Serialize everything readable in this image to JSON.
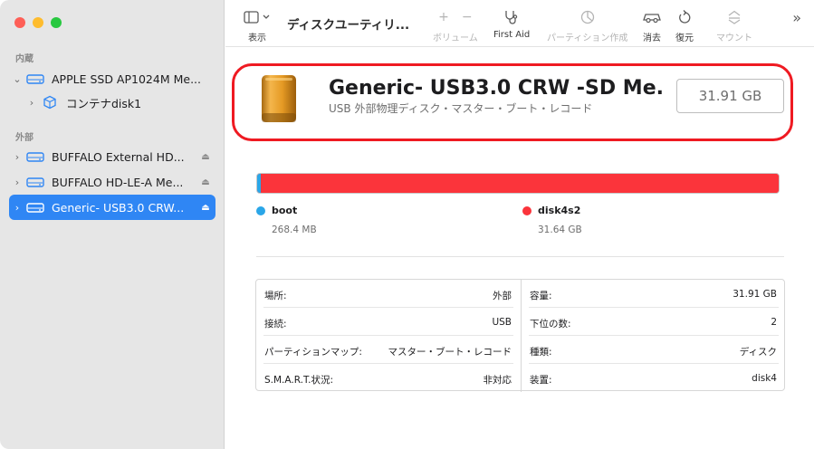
{
  "sidebar": {
    "internal_label": "内蔵",
    "external_label": "外部",
    "items": [
      {
        "label": "APPLE SSD AP1024M Me...",
        "chevron": "⌄"
      },
      {
        "label": "コンテナdisk1",
        "chevron": "›"
      },
      {
        "label": "BUFFALO External HD...",
        "chevron": "›"
      },
      {
        "label": "BUFFALO HD-LE-A Me...",
        "chevron": "›"
      },
      {
        "label": "Generic- USB3.0 CRW...",
        "chevron": "›"
      }
    ],
    "eject_icon": "⏏"
  },
  "toolbar": {
    "view_label": "表示",
    "title": "ディスクユーティリ...",
    "volume_label": "ボリューム",
    "firstaid_label": "First Aid",
    "partition_label": "パーティション作成",
    "erase_label": "消去",
    "restore_label": "復元",
    "mount_label": "マウント",
    "plus": "+",
    "minus": "−",
    "more": "»"
  },
  "device": {
    "name": "Generic- USB3.0 CRW -SD Me...",
    "subtitle": "USB 外部物理ディスク・マスター・ブート・レコード",
    "size": "31.91 GB"
  },
  "partitions": [
    {
      "name": "boot",
      "size": "268.4 MB",
      "color": "#2aa6e8"
    },
    {
      "name": "disk4s2",
      "size": "31.64 GB",
      "color": "#fb343b"
    }
  ],
  "info": {
    "left": [
      {
        "key": "場所:",
        "value": "外部"
      },
      {
        "key": "接続:",
        "value": "USB"
      },
      {
        "key": "パーティションマップ:",
        "value": "マスター・ブート・レコード"
      },
      {
        "key": "S.M.A.R.T.状況:",
        "value": "非対応"
      }
    ],
    "right": [
      {
        "key": "容量:",
        "value": "31.91 GB"
      },
      {
        "key": "下位の数:",
        "value": "2"
      },
      {
        "key": "種類:",
        "value": "ディスク"
      },
      {
        "key": "装置:",
        "value": "disk4"
      }
    ]
  },
  "colors": {
    "accent": "#2f86f4",
    "highlight": "#ef1a22"
  }
}
